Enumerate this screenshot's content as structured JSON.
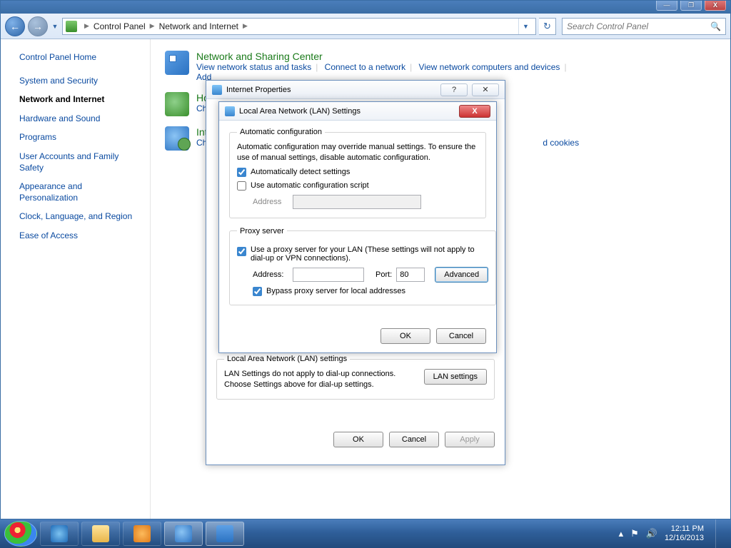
{
  "titlebar": {
    "min": "—",
    "max": "❐",
    "close": "X"
  },
  "nav": {
    "crumbs": [
      "Control Panel",
      "Network and Internet"
    ],
    "search_placeholder": "Search Control Panel"
  },
  "sidebar": {
    "home": "Control Panel Home",
    "items": [
      "System and Security",
      "Network and Internet",
      "Hardware and Sound",
      "Programs",
      "User Accounts and Family Safety",
      "Appearance and Personalization",
      "Clock, Language, and Region",
      "Ease of Access"
    ],
    "active_index": 1
  },
  "content": {
    "nsc": {
      "title": "Network and Sharing Center",
      "links": [
        "View network status and tasks",
        "Connect to a network",
        "View network computers and devices"
      ],
      "extra": "Add"
    },
    "hg": {
      "title_trunc": "Ho",
      "link_trunc": "Choo"
    },
    "io": {
      "title_trunc": "Inte",
      "link_trunc": "Chan",
      "tail": "d cookies"
    }
  },
  "inetprops": {
    "title": "Internet Properties",
    "lan_section_title": "Local Area Network (LAN) settings",
    "lan_desc": "LAN Settings do not apply to dial-up connections. Choose Settings above for dial-up settings.",
    "lan_btn": "LAN settings",
    "ok": "OK",
    "cancel": "Cancel",
    "apply": "Apply"
  },
  "lan": {
    "title": "Local Area Network (LAN) Settings",
    "auto_legend": "Automatic configuration",
    "auto_desc": "Automatic configuration may override manual settings.  To ensure the use of manual settings, disable automatic configuration.",
    "auto_detect": "Automatically detect settings",
    "auto_detect_checked": true,
    "use_script": "Use automatic configuration script",
    "use_script_checked": false,
    "addr_label": "Address",
    "proxy_legend": "Proxy server",
    "proxy_use": "Use a proxy server for your LAN (These settings will not apply to dial-up or VPN connections).",
    "proxy_use_checked": true,
    "proxy_addr_label": "Address:",
    "proxy_addr": "",
    "proxy_port_label": "Port:",
    "proxy_port": "80",
    "advanced": "Advanced",
    "bypass": "Bypass proxy server for local addresses",
    "bypass_checked": true,
    "ok": "OK",
    "cancel": "Cancel"
  },
  "taskbar": {
    "time": "12:11 PM",
    "date": "12/16/2013"
  }
}
